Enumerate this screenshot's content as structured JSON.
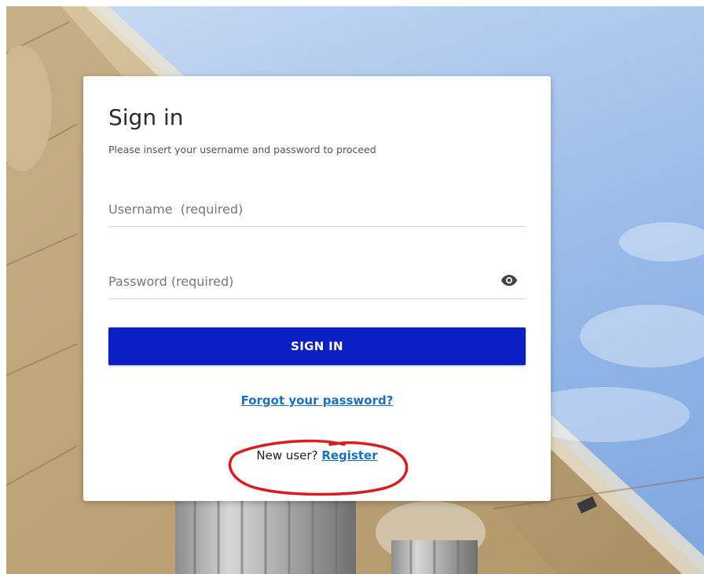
{
  "signin": {
    "title": "Sign in",
    "subtitle": "Please insert your username and password to proceed",
    "username_placeholder": "Username  (required)",
    "password_placeholder": "Password (required)",
    "submit_label": "SIGN IN",
    "forgot_label": "Forgot your password?",
    "new_user_text": "New user?",
    "register_label": "Register"
  },
  "colors": {
    "button": "#0a1fc4",
    "link": "#1a6fc4",
    "annotation": "#d81e1e"
  }
}
